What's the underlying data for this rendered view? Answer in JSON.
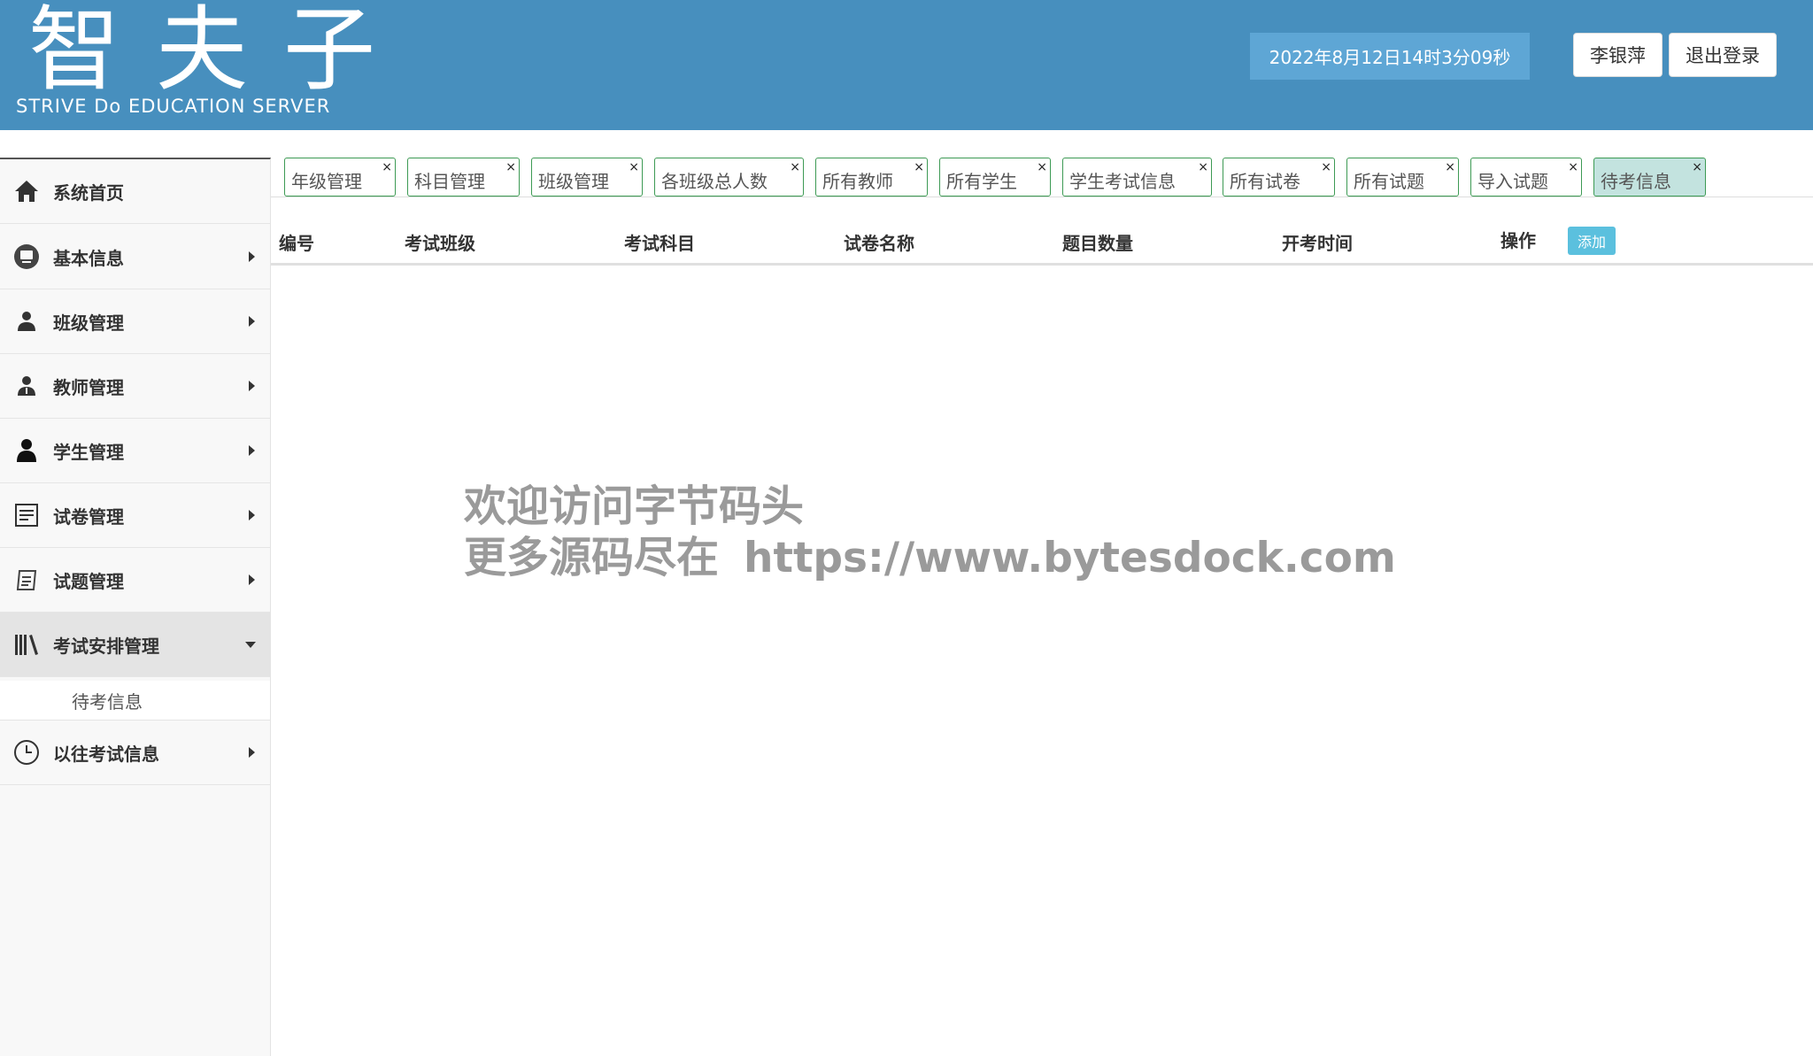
{
  "header": {
    "logo_cn": "智夫子",
    "logo_en": "STRIVE Do EDUCATION SERVER",
    "datetime": "2022年8月12日14时3分09秒",
    "user_name": "李银萍",
    "logout_label": "退出登录",
    "bg_color": "#478fbe"
  },
  "sidebar": {
    "items": [
      {
        "label": "系统首页",
        "icon": "home-icon"
      },
      {
        "label": "基本信息",
        "icon": "monitor-icon"
      },
      {
        "label": "班级管理",
        "icon": "user-group-icon"
      },
      {
        "label": "教师管理",
        "icon": "teacher-icon"
      },
      {
        "label": "学生管理",
        "icon": "student-icon"
      },
      {
        "label": "试卷管理",
        "icon": "paper-icon"
      },
      {
        "label": "试题管理",
        "icon": "question-icon"
      },
      {
        "label": "考试安排管理",
        "icon": "books-icon"
      },
      {
        "label": "以往考试信息",
        "icon": "clock-icon"
      }
    ],
    "sub_item": "待考信息"
  },
  "tabs": [
    {
      "label": "年级管理"
    },
    {
      "label": "科目管理"
    },
    {
      "label": "班级管理"
    },
    {
      "label": "各班级总人数"
    },
    {
      "label": "所有教师"
    },
    {
      "label": "所有学生"
    },
    {
      "label": "学生考试信息"
    },
    {
      "label": "所有试卷"
    },
    {
      "label": "所有试题"
    },
    {
      "label": "导入试题"
    },
    {
      "label": "待考信息"
    }
  ],
  "tab_close": "×",
  "table": {
    "columns": [
      "编号",
      "考试班级",
      "考试科目",
      "试卷名称",
      "题目数量",
      "开考时间",
      "操作"
    ],
    "add_label": "添加",
    "rows": []
  },
  "watermark": {
    "line1": "欢迎访问字节码头",
    "line2": "更多源码尽在",
    "url": "https://www.bytesdock.com"
  }
}
